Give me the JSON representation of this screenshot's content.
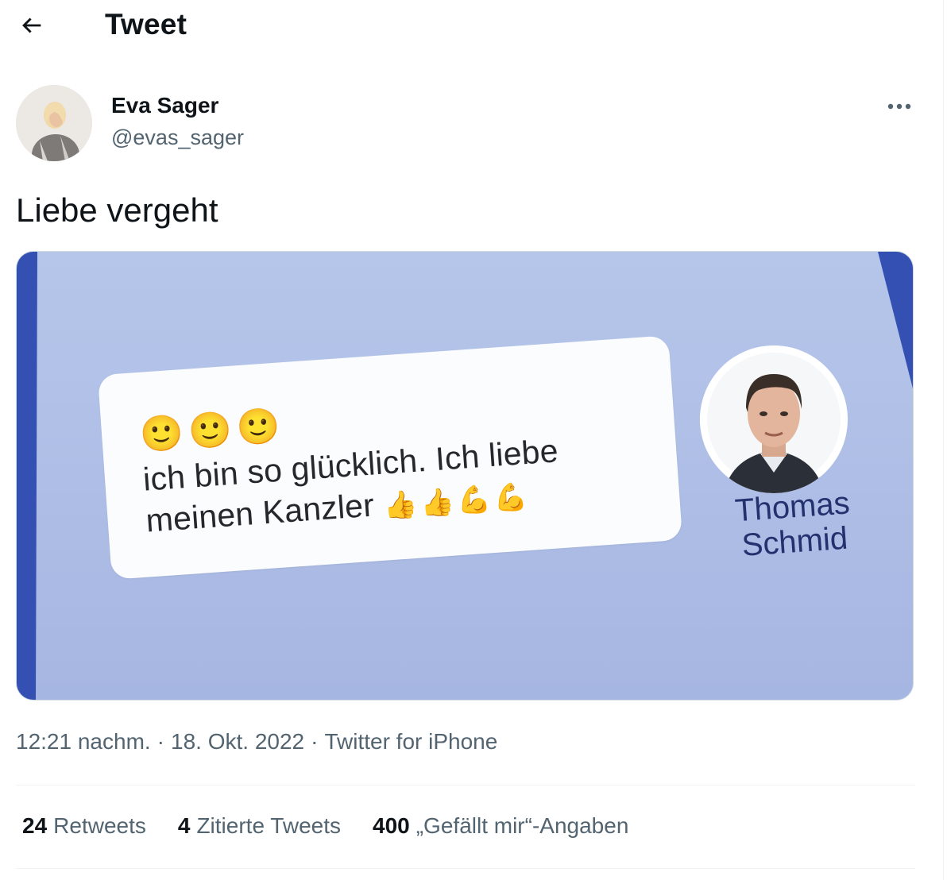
{
  "header": {
    "title": "Tweet",
    "back_icon": "arrow-left-icon"
  },
  "author": {
    "name": "Eva Sager",
    "handle": "@evas_sager",
    "more_icon": "more-horizontal-icon"
  },
  "tweet": {
    "text": "Liebe vergeht",
    "image": {
      "bubble_emojis": "🙂🙂🙂",
      "bubble_line1": "ich bin so glücklich. Ich liebe",
      "bubble_line2": "meinen Kanzler",
      "bubble_line2_emojis": "👍👍💪💪",
      "caption_first": "Thomas",
      "caption_last": "Schmid",
      "background_color": "#aebfe6",
      "caption_color": "#23326f"
    }
  },
  "meta": {
    "time": "12:21 nachm.",
    "date": "18. Okt. 2022",
    "source": "Twitter for iPhone",
    "separator": "·"
  },
  "stats": [
    {
      "count": "24",
      "label": "Retweets"
    },
    {
      "count": "4",
      "label": "Zitierte Tweets"
    },
    {
      "count": "400",
      "label": "„Gefällt mir“-Angaben"
    }
  ]
}
